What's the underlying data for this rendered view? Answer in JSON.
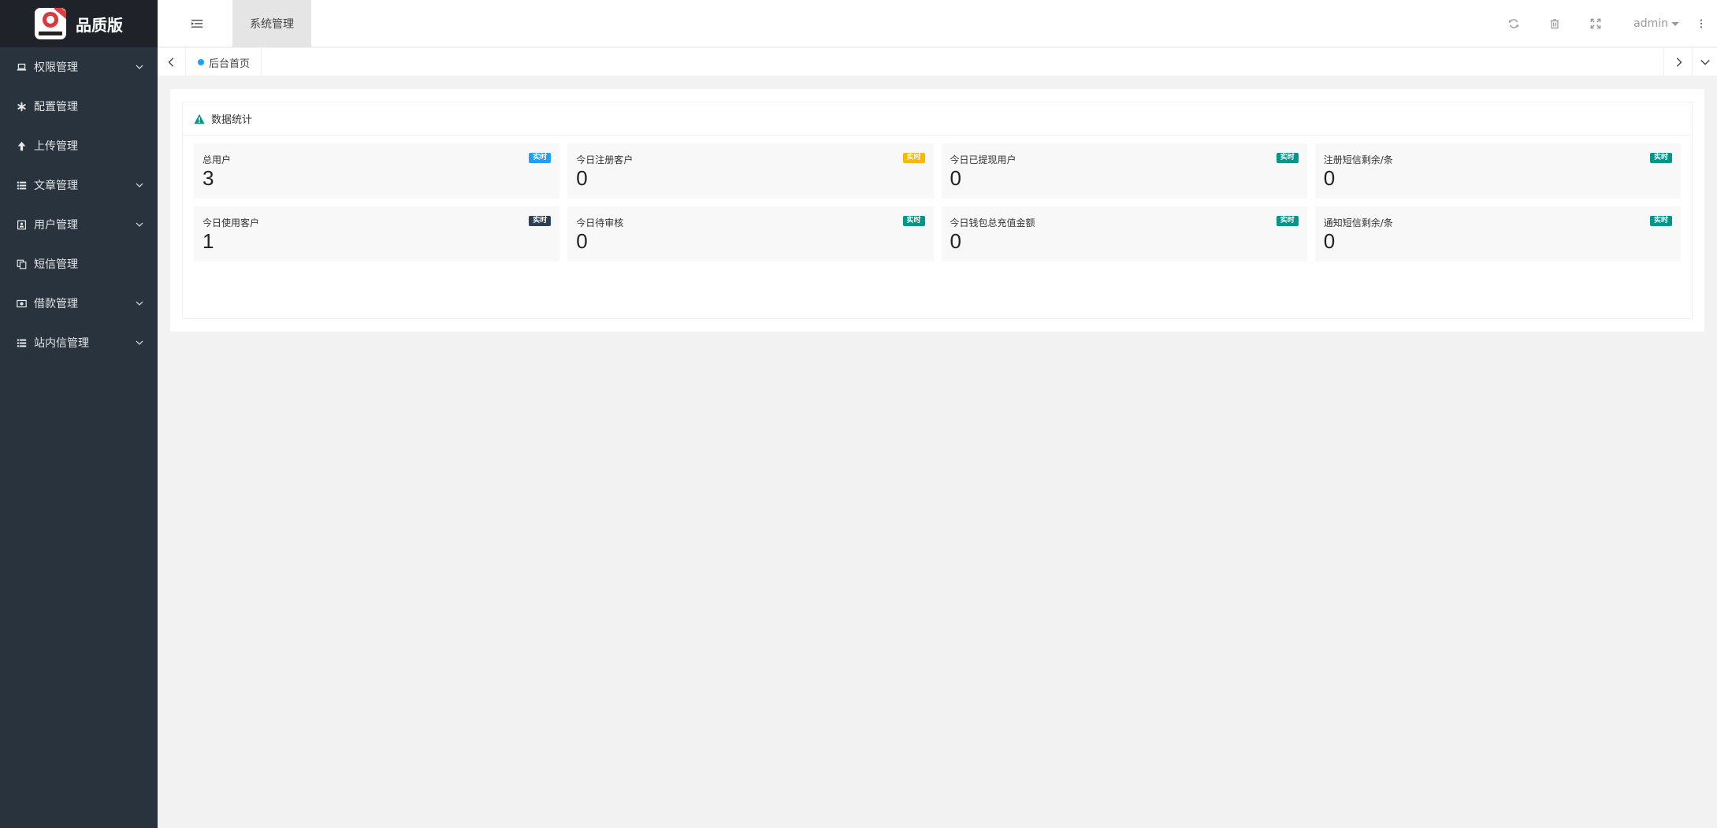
{
  "brand": {
    "title": "品质版"
  },
  "sidebar": {
    "items": [
      {
        "label": "权限管理",
        "icon": "laptop-icon",
        "expandable": true
      },
      {
        "label": "配置管理",
        "icon": "asterisk-icon",
        "expandable": false
      },
      {
        "label": "上传管理",
        "icon": "arrow-up-icon",
        "expandable": false
      },
      {
        "label": "文章管理",
        "icon": "list-icon",
        "expandable": true
      },
      {
        "label": "用户管理",
        "icon": "user-badge-icon",
        "expandable": true
      },
      {
        "label": "短信管理",
        "icon": "copy-icon",
        "expandable": false
      },
      {
        "label": "借款管理",
        "icon": "money-icon",
        "expandable": true
      },
      {
        "label": "站内信管理",
        "icon": "list-icon",
        "expandable": true
      }
    ]
  },
  "header": {
    "active_tab": "系统管理",
    "user": "admin"
  },
  "tabs": {
    "home": "后台首页"
  },
  "panel": {
    "title": "数据统计",
    "cards": [
      {
        "title": "总用户",
        "value": "3",
        "badge": "实时",
        "badge_color": "#1e9fff"
      },
      {
        "title": "今日注册客户",
        "value": "0",
        "badge": "实时",
        "badge_color": "#ffb800"
      },
      {
        "title": "今日已提现用户",
        "value": "0",
        "badge": "实时",
        "badge_color": "#009688"
      },
      {
        "title": "注册短信剩余/条",
        "value": "0",
        "badge": "实时",
        "badge_color": "#009688"
      },
      {
        "title": "今日使用客户",
        "value": "1",
        "badge": "实时",
        "badge_color": "#2f4056"
      },
      {
        "title": "今日待审核",
        "value": "0",
        "badge": "实时",
        "badge_color": "#009688"
      },
      {
        "title": "今日钱包总充值金额",
        "value": "0",
        "badge": "实时",
        "badge_color": "#009688"
      },
      {
        "title": "通知短信剩余/条",
        "value": "0",
        "badge": "实时",
        "badge_color": "#009688"
      }
    ]
  },
  "colors": {
    "sidebar_bg": "#28333e",
    "logo_bar_bg": "#20222a",
    "accent_blue": "#1e9fff",
    "accent_green": "#009688",
    "accent_orange": "#ffb800"
  }
}
